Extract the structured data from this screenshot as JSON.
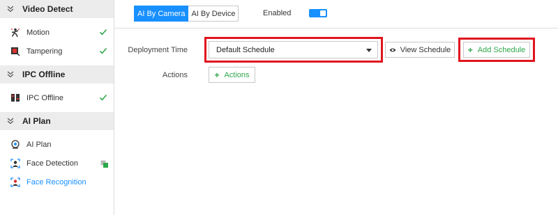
{
  "sidebar": {
    "sections": [
      {
        "title": "Video Detect",
        "items": [
          {
            "label": "Motion",
            "status": "check"
          },
          {
            "label": "Tampering",
            "status": "check"
          }
        ]
      },
      {
        "title": "IPC Offline",
        "items": [
          {
            "label": "IPC Offline",
            "status": "check"
          }
        ]
      },
      {
        "title": "AI Plan",
        "items": [
          {
            "label": "AI Plan",
            "status": ""
          },
          {
            "label": "Face Detection",
            "status": "partial"
          },
          {
            "label": "Face Recognition",
            "status": "",
            "active": true
          }
        ]
      }
    ]
  },
  "topbar": {
    "tabs": [
      "AI By Camera",
      "AI By Device"
    ],
    "active_tab": "AI By Camera",
    "enabled_label": "Enabled",
    "enabled": true
  },
  "form": {
    "deployment_time_label": "Deployment Time",
    "schedule_value": "Default Schedule",
    "view_schedule_label": "View Schedule",
    "add_schedule_label": "Add Schedule",
    "actions_label": "Actions",
    "actions_button_label": "Actions"
  },
  "colors": {
    "accent": "#1890ff",
    "success": "#2ea84a",
    "highlight": "#e0141e"
  }
}
